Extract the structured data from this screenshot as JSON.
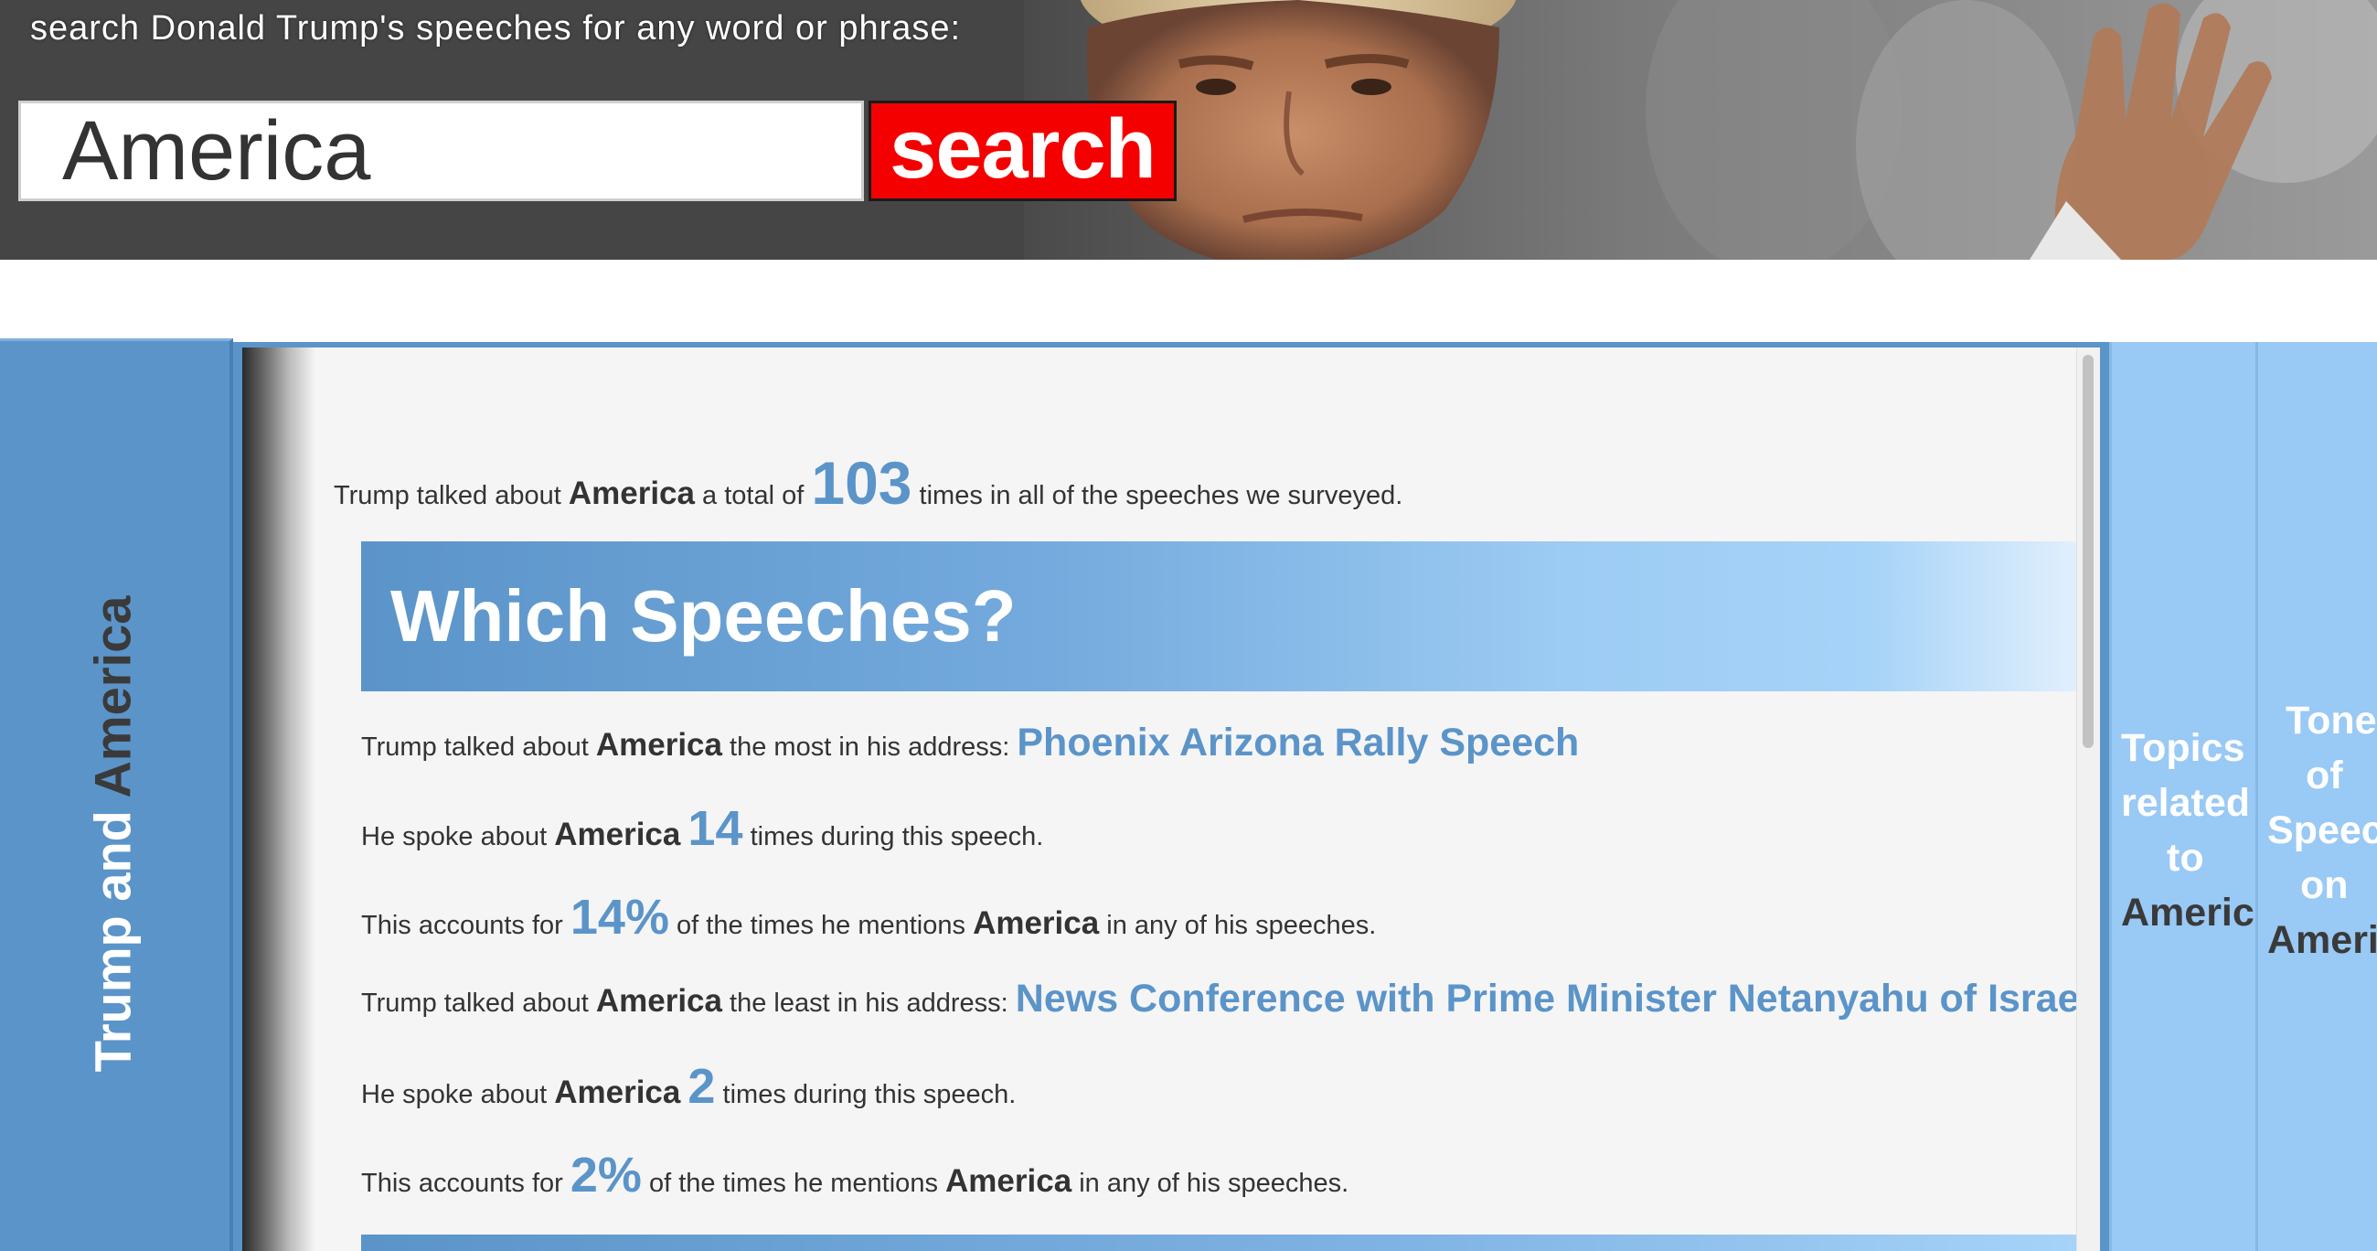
{
  "header": {
    "prompt": "search Donald Trump's speeches for any word or phrase:",
    "search_value": "America",
    "search_button": "search"
  },
  "left_tab": {
    "part1": "Trump and",
    "part2": "America"
  },
  "summary": {
    "pre": "Trump talked about",
    "term": "America",
    "mid": "a total of",
    "total": "103",
    "post": "times in all of the speeches we surveyed."
  },
  "which_speeches": {
    "title": "Which Speeches?",
    "most": {
      "pre": "Trump talked about",
      "term": "America",
      "mid": "the most in his address:",
      "speech": "Phoenix Arizona Rally Speech"
    },
    "most_count": {
      "pre": "He spoke about",
      "term": "America",
      "count": "14",
      "post": "times during this speech."
    },
    "most_pct": {
      "pre": "This accounts for",
      "pct": "14%",
      "mid": "of the times he mentions",
      "term": "America",
      "post": "in any of his speeches."
    },
    "least": {
      "pre": "Trump talked about",
      "term": "America",
      "mid": "the least in his address:",
      "speech": "News Conference with Prime Minister Netanyahu of Israe"
    },
    "least_count": {
      "pre": "He spoke about",
      "term": "America",
      "count": "2",
      "post": "times during this speech."
    },
    "least_pct": {
      "pre": "This accounts for",
      "pct": "2%",
      "mid": "of the times he mentions",
      "term": "America",
      "post": "in any of his speeches."
    }
  },
  "right_tabs": {
    "topics": {
      "l1": "Topics",
      "l2": "related",
      "l3": "to",
      "l4": "Americ"
    },
    "tone": {
      "l1": "Tone",
      "l2": "of",
      "l3": "Speec",
      "l4": "on",
      "l5": "Ameri"
    }
  },
  "colors": {
    "accent_blue": "#5b94c9",
    "light_blue": "#99c9f5",
    "search_red": "#f40000",
    "header_gray": "#454545"
  }
}
